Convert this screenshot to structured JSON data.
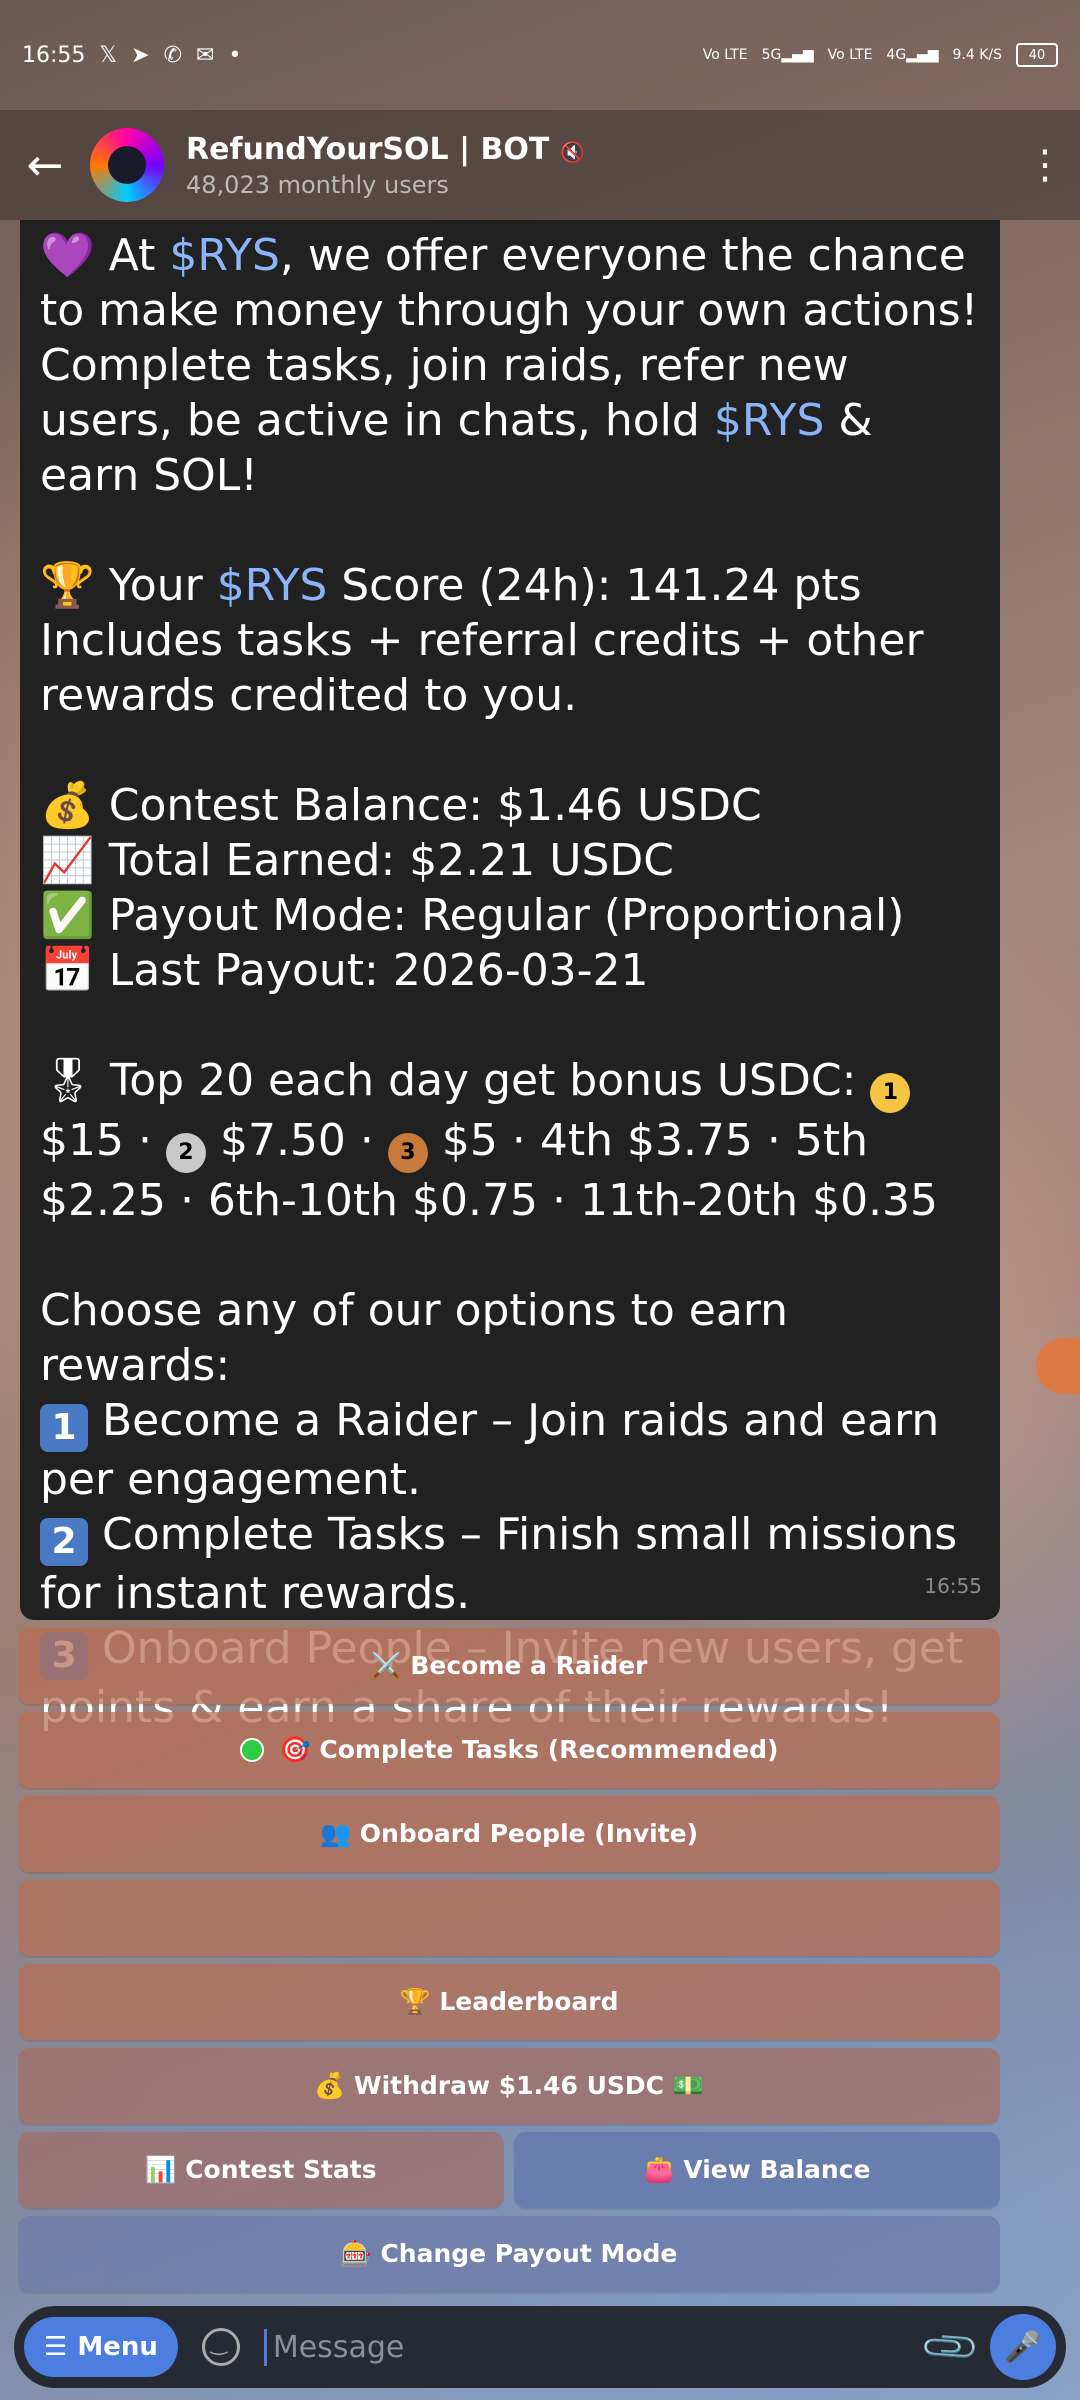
{
  "status": {
    "time": "16:55",
    "icons": [
      "x-icon",
      "telegram-icon",
      "whatsapp-icon",
      "gmail-icon"
    ],
    "net1": "Vo LTE",
    "net2": "5G",
    "net3": "Vo LTE",
    "net4": "4G",
    "speed": "9.4 K/S",
    "battery": "40"
  },
  "header": {
    "title": "RefundYourSOL | BOT",
    "subtitle": "48,023 monthly users"
  },
  "message": {
    "intro_pre": "💜 At ",
    "brand": "$RYS",
    "intro_post": ", we offer everyone the chance to make money through your own actions! Complete tasks, join raids, refer new users, be active in chats, hold ",
    "intro_end": " & earn SOL!",
    "score_pre": "🏆 Your ",
    "score_post": " Score (24h): 141.24 pts",
    "score_note": "Includes tasks + referral credits + other rewards credited to you.",
    "balance": "💰 Contest Balance: $1.46 USDC",
    "earned": "📈 Total Earned: $2.21 USDC",
    "payout_mode": "✅ Payout Mode: Regular (Proportional)",
    "last_payout": "📅 Last Payout: 2026-03-21",
    "top_pre": "🎖 Top 20 each day get bonus USDC: ",
    "top_1": "$15",
    "top_2": "$7.50",
    "top_3": "$5 · 4th $3.75 · 5th $2.25 · 6th-10th $0.75 · 11th-20th $0.35",
    "choose": "Choose any of our options to earn rewards:",
    "opt1": "Become a Raider – Join raids and earn per engagement.",
    "opt2": "Complete Tasks – Finish small missions for instant rewards.",
    "opt3": "Onboard People – Invite new users, get points & earn a share of their rewards!",
    "time": "16:55"
  },
  "buttons": {
    "raider": "⚔️ Become a Raider",
    "tasks": "🎯 Complete Tasks (Recommended)",
    "onboard": "👥 Onboard People (Invite)",
    "blank": "",
    "leaderboard": "🏆 Leaderboard",
    "withdraw": "💰 Withdraw $1.46 USDC 💵",
    "contest_stats": "📊 Contest Stats",
    "view_balance": "👛 View Balance",
    "change_payout": "🎰 Change Payout Mode"
  },
  "input": {
    "menu_label": "Menu",
    "placeholder": "Message"
  }
}
